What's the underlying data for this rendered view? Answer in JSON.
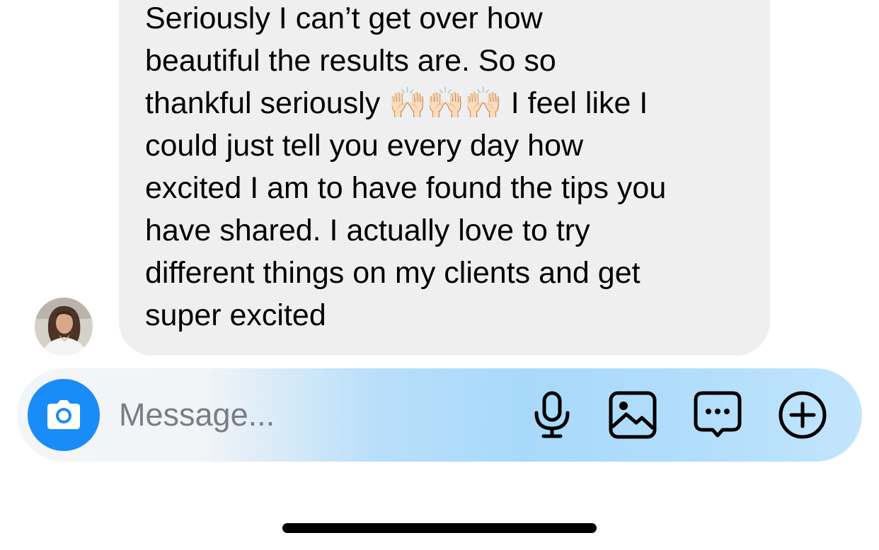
{
  "conversation": {
    "incoming_message": {
      "text": "Seriously I can’t get over how\nbeautiful the results are. So so\nthankful seriously 🙌🏻🙌🏻🙌🏻 I feel like I\ncould just tell you every day how\nexcited I am to have found the tips you\nhave shared. I actually love to try\ndifferent things on my clients and get\nsuper excited",
      "sender_avatar": "avatar-photo"
    }
  },
  "composer": {
    "placeholder": "Message...",
    "value": "",
    "icons": {
      "camera": "camera-icon",
      "microphone": "microphone-icon",
      "gallery": "image-gallery-icon",
      "sticker": "chat-bubble-ellipsis-icon",
      "more": "plus-circle-icon"
    }
  },
  "colors": {
    "bubble_background": "#efefef",
    "camera_button": "#1a8cf7",
    "placeholder_text": "#7a7d83",
    "composer_gradient_light": "#f4f5f7",
    "composer_gradient_blue": "#a8d9fb"
  }
}
